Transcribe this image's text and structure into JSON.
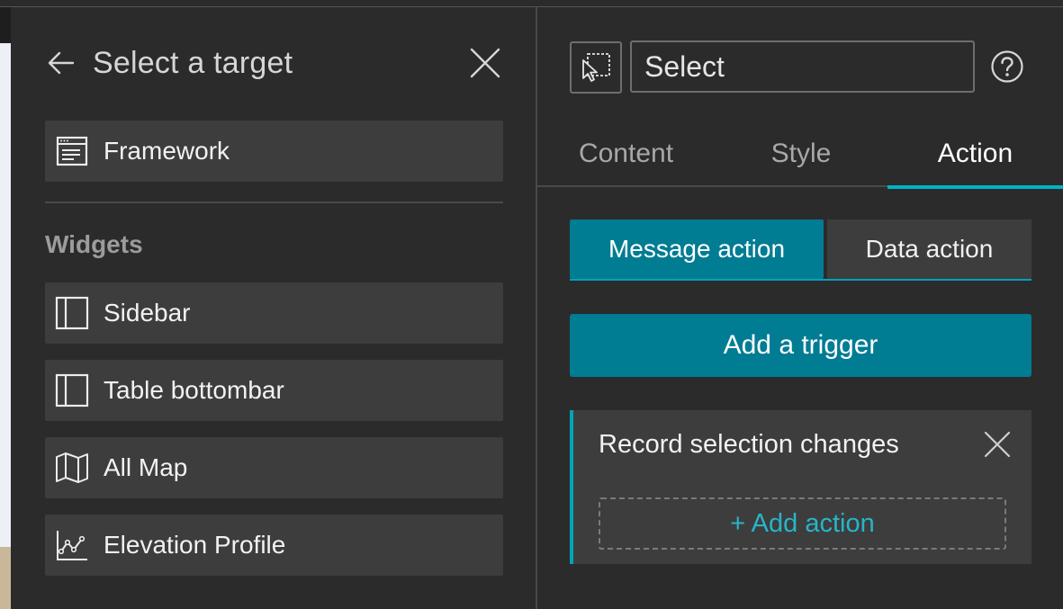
{
  "left_panel": {
    "title": "Select a target",
    "framework_label": "Framework",
    "section_label": "Widgets",
    "widgets": [
      {
        "label": "Sidebar",
        "icon": "sidebar-layout-icon"
      },
      {
        "label": "Table bottombar",
        "icon": "sidebar-layout-icon"
      },
      {
        "label": "All Map",
        "icon": "map-icon"
      },
      {
        "label": "Elevation Profile",
        "icon": "line-chart-icon"
      }
    ]
  },
  "right_panel": {
    "widget_name": "Select",
    "tabs": [
      {
        "label": "Content",
        "active": false
      },
      {
        "label": "Style",
        "active": false
      },
      {
        "label": "Action",
        "active": true
      }
    ],
    "segments": [
      {
        "label": "Message action",
        "active": true
      },
      {
        "label": "Data action",
        "active": false
      }
    ],
    "add_trigger_label": "Add a trigger",
    "trigger": {
      "title": "Record selection changes",
      "add_action_label": "+ Add action"
    }
  },
  "colors": {
    "background": "#2b2b2b",
    "item_background": "#3d3d3d",
    "accent": "#007c93",
    "accent_bright": "#00b3c7",
    "link": "#27b5c9"
  }
}
